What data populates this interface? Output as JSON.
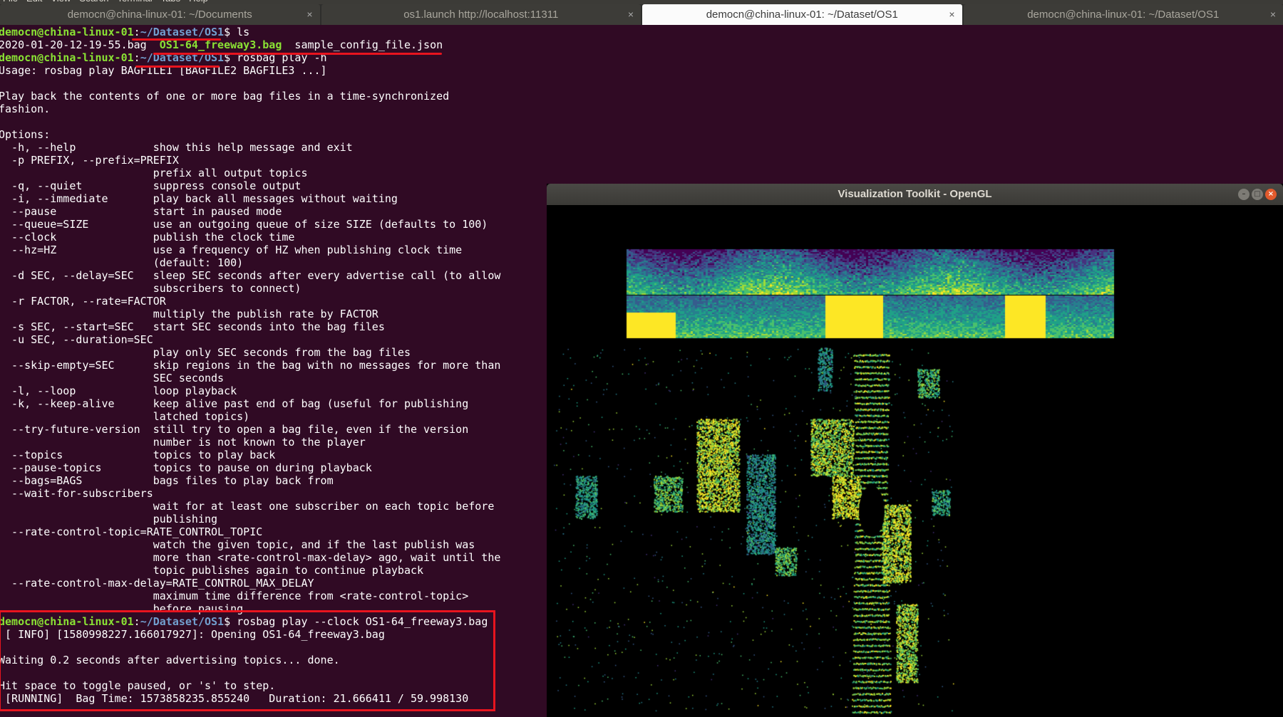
{
  "menubar": {
    "items": [
      "File",
      "Edit",
      "View",
      "Search",
      "Terminal",
      "Tabs",
      "Help"
    ]
  },
  "tabs": [
    {
      "title": "democn@china-linux-01: ~/Documents",
      "active": false
    },
    {
      "title": "os1.launch http://localhost:11311",
      "active": false
    },
    {
      "title": "democn@china-linux-01: ~/Dataset/OS1",
      "active": true
    },
    {
      "title": "democn@china-linux-01: ~/Dataset/OS1",
      "active": false
    }
  ],
  "tab_close_glyph": "×",
  "terminal": {
    "colors": {
      "background": "#300a24",
      "user_host": "#8ae234",
      "path": "#729fcf",
      "text": "#ffffff"
    },
    "lines": [
      [
        {
          "t": "democn@china-linux-01",
          "c": "u"
        },
        {
          "t": ":",
          "c": "c"
        },
        {
          "t": "~/Dataset/OS1",
          "c": "p"
        },
        {
          "t": "$ ls",
          "c": "c"
        }
      ],
      [
        {
          "t": "2020-01-20-12-19-55.bag  ",
          "c": "c"
        },
        {
          "t": "OS1-64_freeway3.bag",
          "c": "fg"
        },
        {
          "t": "  sample_config_file.json",
          "c": "c"
        }
      ],
      [
        {
          "t": "democn@china-linux-01",
          "c": "u"
        },
        {
          "t": ":",
          "c": "c"
        },
        {
          "t": "~/Dataset/OS1",
          "c": "p"
        },
        {
          "t": "$ rosbag play -h",
          "c": "c"
        }
      ],
      [
        {
          "t": "Usage: rosbag play BAGFILE1 [BAGFILE2 BAGFILE3 ...]",
          "c": "c"
        }
      ],
      [
        {
          "t": "",
          "c": "c"
        }
      ],
      [
        {
          "t": "Play back the contents of one or more bag files in a time-synchronized",
          "c": "c"
        }
      ],
      [
        {
          "t": "fashion.",
          "c": "c"
        }
      ],
      [
        {
          "t": "",
          "c": "c"
        }
      ],
      [
        {
          "t": "Options:",
          "c": "c"
        }
      ],
      [
        {
          "t": "  -h, --help            show this help message and exit",
          "c": "c"
        }
      ],
      [
        {
          "t": "  -p PREFIX, --prefix=PREFIX",
          "c": "c"
        }
      ],
      [
        {
          "t": "                        prefix all output topics",
          "c": "c"
        }
      ],
      [
        {
          "t": "  -q, --quiet           suppress console output",
          "c": "c"
        }
      ],
      [
        {
          "t": "  -i, --immediate       play back all messages without waiting",
          "c": "c"
        }
      ],
      [
        {
          "t": "  --pause               start in paused mode",
          "c": "c"
        }
      ],
      [
        {
          "t": "  --queue=SIZE          use an outgoing queue of size SIZE (defaults to 100)",
          "c": "c"
        }
      ],
      [
        {
          "t": "  --clock               publish the clock time",
          "c": "c"
        }
      ],
      [
        {
          "t": "  --hz=HZ               use a frequency of HZ when publishing clock time",
          "c": "c"
        }
      ],
      [
        {
          "t": "                        (default: 100)",
          "c": "c"
        }
      ],
      [
        {
          "t": "  -d SEC, --delay=SEC   sleep SEC seconds after every advertise call (to allow",
          "c": "c"
        }
      ],
      [
        {
          "t": "                        subscribers to connect)",
          "c": "c"
        }
      ],
      [
        {
          "t": "  -r FACTOR, --rate=FACTOR",
          "c": "c"
        }
      ],
      [
        {
          "t": "                        multiply the publish rate by FACTOR",
          "c": "c"
        }
      ],
      [
        {
          "t": "  -s SEC, --start=SEC   start SEC seconds into the bag files",
          "c": "c"
        }
      ],
      [
        {
          "t": "  -u SEC, --duration=SEC",
          "c": "c"
        }
      ],
      [
        {
          "t": "                        play only SEC seconds from the bag files",
          "c": "c"
        }
      ],
      [
        {
          "t": "  --skip-empty=SEC      skip regions in the bag with no messages for more than",
          "c": "c"
        }
      ],
      [
        {
          "t": "                        SEC seconds",
          "c": "c"
        }
      ],
      [
        {
          "t": "  -l, --loop            loop playback",
          "c": "c"
        }
      ],
      [
        {
          "t": "  -k, --keep-alive      keep alive past end of bag (useful for publishing",
          "c": "c"
        }
      ],
      [
        {
          "t": "                        latched topics)",
          "c": "c"
        }
      ],
      [
        {
          "t": "  --try-future-version  still try to open a bag file, even if the version",
          "c": "c"
        }
      ],
      [
        {
          "t": "                        number is not known to the player",
          "c": "c"
        }
      ],
      [
        {
          "t": "  --topics              topics to play back",
          "c": "c"
        }
      ],
      [
        {
          "t": "  --pause-topics        topics to pause on during playback",
          "c": "c"
        }
      ],
      [
        {
          "t": "  --bags=BAGS           bags files to play back from",
          "c": "c"
        }
      ],
      [
        {
          "t": "  --wait-for-subscribers",
          "c": "c"
        }
      ],
      [
        {
          "t": "                        wait for at least one subscriber on each topic before",
          "c": "c"
        }
      ],
      [
        {
          "t": "                        publishing",
          "c": "c"
        }
      ],
      [
        {
          "t": "  --rate-control-topic=RATE_CONTROL_TOPIC",
          "c": "c"
        }
      ],
      [
        {
          "t": "                        watch the given topic, and if the last publish was",
          "c": "c"
        }
      ],
      [
        {
          "t": "                        more than <rate-control-max-delay> ago, wait until the",
          "c": "c"
        }
      ],
      [
        {
          "t": "                        topic publishes again to continue playback",
          "c": "c"
        }
      ],
      [
        {
          "t": "  --rate-control-max-delay=RATE_CONTROL_MAX_DELAY",
          "c": "c"
        }
      ],
      [
        {
          "t": "                        maximum time difference from <rate-control-topic>",
          "c": "c"
        }
      ],
      [
        {
          "t": "                        before pausing",
          "c": "c"
        }
      ],
      [
        {
          "t": "democn@china-linux-01",
          "c": "u"
        },
        {
          "t": ":",
          "c": "c"
        },
        {
          "t": "~/Dataset/OS1",
          "c": "p"
        },
        {
          "t": "$ rosbag play --clock OS1-64_freeway3.bag",
          "c": "c"
        }
      ],
      [
        {
          "t": " [ INFO] [1580998227.166017927]: Opening OS1-64_freeway3.bag",
          "c": "c"
        }
      ],
      [
        {
          "t": "",
          "c": "c"
        }
      ],
      [
        {
          "t": "Waiting 0.2 seconds after advertising topics... done.",
          "c": "c"
        }
      ],
      [
        {
          "t": "",
          "c": "c"
        }
      ],
      [
        {
          "t": "Hit space to toggle paused, or 's' to step.",
          "c": "c"
        }
      ],
      [
        {
          "t": " [RUNNING]  Bag Time: 1573858235.855240   Duration: 21.666411 / 59.998130",
          "c": "c"
        }
      ]
    ]
  },
  "vtk_window": {
    "title": "Visualization Toolkit - OpenGL",
    "buttons": {
      "minimize": "–",
      "maximize": "□",
      "close": "×"
    },
    "colors": {
      "background": "#000000",
      "titlebar": "#3c3b37",
      "viridis": [
        "#440154",
        "#3b528b",
        "#21918c",
        "#5ec962",
        "#fde725"
      ]
    }
  },
  "annotations": {
    "color": "#e8141e"
  }
}
